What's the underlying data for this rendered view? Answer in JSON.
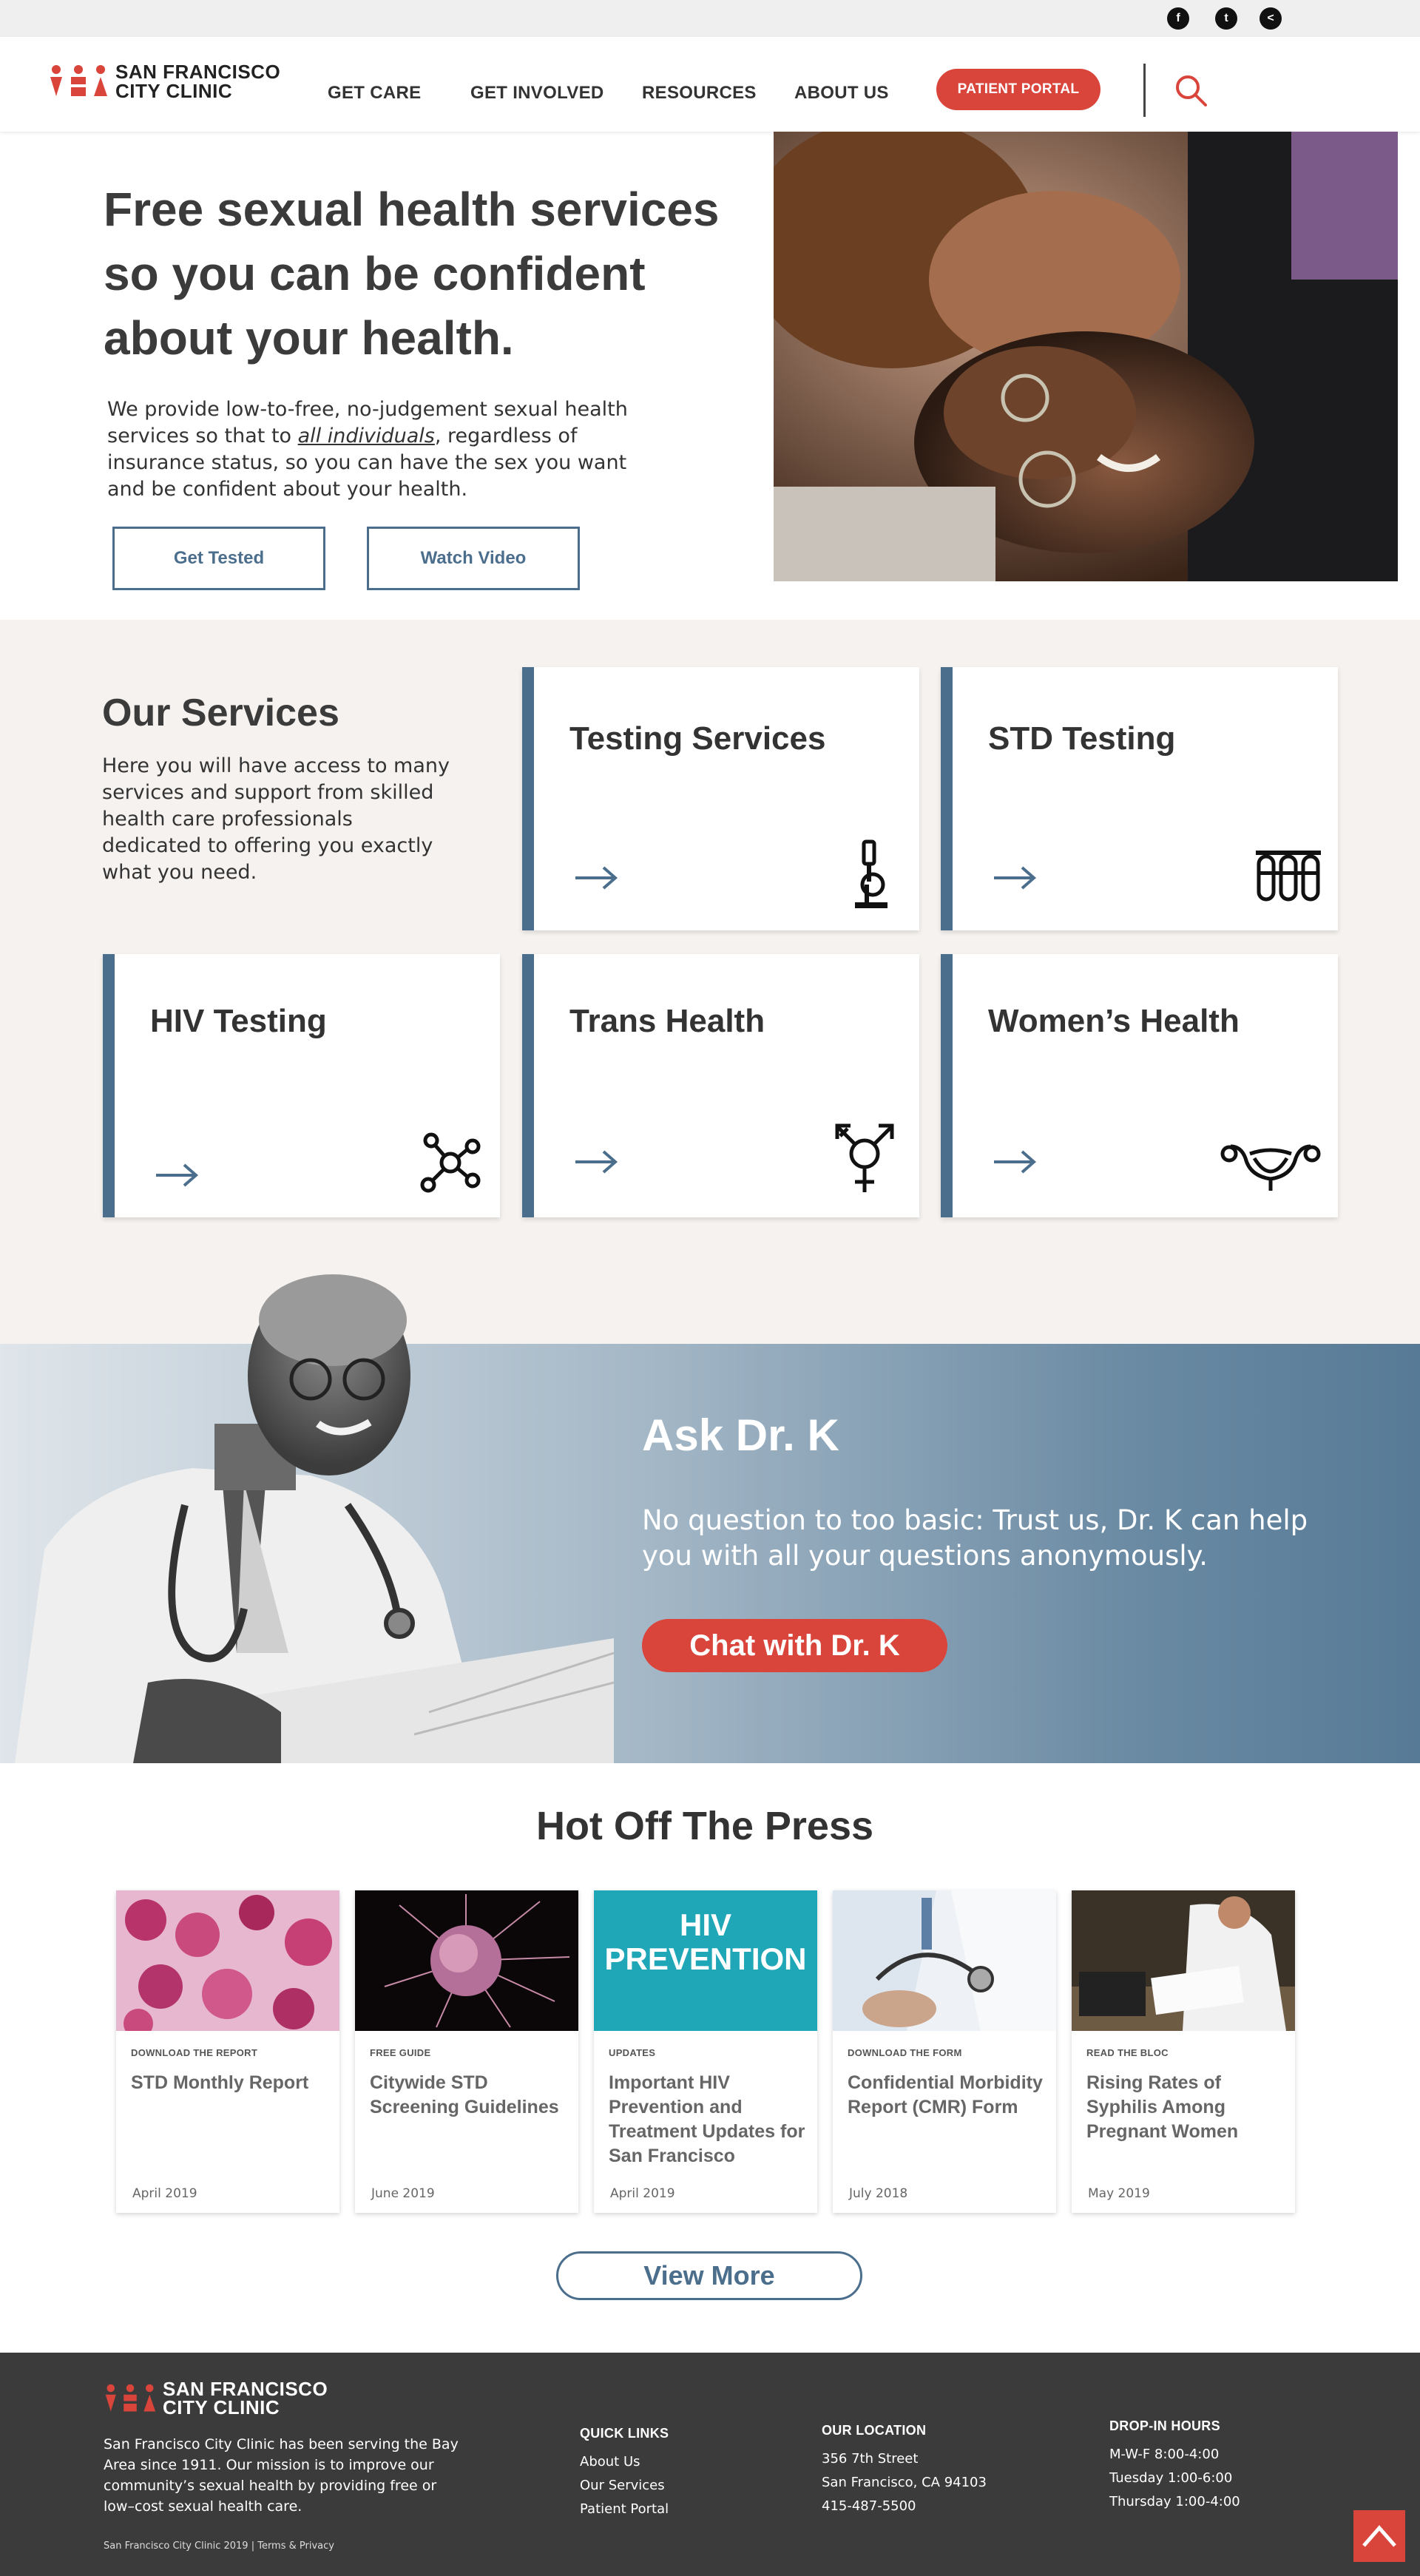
{
  "brand": {
    "name_line1": "SAN FRANCISCO",
    "name_line2": "CITY CLINIC",
    "accent_color": "#d9453b",
    "primary_color": "#4b6e8c"
  },
  "topbar": {
    "social": [
      {
        "name": "facebook-icon",
        "glyph": "f"
      },
      {
        "name": "twitter-icon",
        "glyph": "t"
      },
      {
        "name": "share-icon",
        "glyph": "<"
      }
    ]
  },
  "nav": {
    "items": [
      "GET CARE",
      "GET INVOLVED",
      "RESOURCES",
      "ABOUT US"
    ],
    "portal_label": "PATIENT PORTAL",
    "search_icon": "search-icon"
  },
  "hero": {
    "title": "Free sexual health services so you can be confident about your health.",
    "text_before": "We provide low-to-free, no-judgement sexual health services so that to ",
    "text_emphasis": "all individuals",
    "text_after": ", regardless of insurance status, so you can have the sex you want and be confident about your health.",
    "buttons": [
      "Get Tested",
      "Watch Video"
    ]
  },
  "services": {
    "title": "Our Services",
    "text": "Here you will have access to many services and support from skilled health care professionals dedicated to offering you exactly what you need.",
    "cards": [
      {
        "title": "Testing Services",
        "icon": "microscope-icon"
      },
      {
        "title": "STD Testing",
        "icon": "test-tubes-icon"
      },
      {
        "title": "HIV Testing",
        "icon": "molecule-icon"
      },
      {
        "title": "Trans Health",
        "icon": "transgender-symbol-icon"
      },
      {
        "title": "Women’s Health",
        "icon": "uterus-icon"
      }
    ]
  },
  "ask": {
    "title": "Ask Dr. K",
    "text": "No question to too basic: Trust us, Dr. K can help you with all your questions anonymously.",
    "button": "Chat with Dr. K"
  },
  "press": {
    "title": "Hot Off The Press",
    "items": [
      {
        "kicker": "DOWNLOAD THE REPORT",
        "title": "STD Monthly Report",
        "date": "April 2019"
      },
      {
        "kicker": "FREE GUIDE",
        "title": "Citywide STD Screening Guidelines",
        "date": "June 2019"
      },
      {
        "kicker": "UPDATES",
        "title": "Important HIV Prevention and Treatment Updates for San Francisco",
        "date": "April 2019",
        "image_text": "HIV PREVENTION"
      },
      {
        "kicker": "DOWNLOAD THE FORM",
        "title": "Confidential Morbidity Report (CMR) Form",
        "date": "July 2018"
      },
      {
        "kicker": "READ THE BLOC",
        "title": "Rising Rates of Syphilis Among Pregnant Women",
        "date": "May 2019"
      }
    ],
    "view_more": "View More"
  },
  "footer": {
    "about": "San Francisco City Clinic has been serving the Bay Area since 1911. Our mission is to improve our community’s sexual health by providing free or low–cost sexual health care.",
    "copyright": "San Francisco City Clinic 2019  |  Terms & Privacy",
    "quick_links_title": "QUICK LINKS",
    "quick_links": [
      "About Us",
      "Our Services",
      "Patient Portal"
    ],
    "location_title": "OUR LOCATION",
    "location": [
      "356 7th Street",
      "San Francisco, CA 94103",
      "415-487-5500"
    ],
    "hours_title": "DROP-IN HOURS",
    "hours": [
      "M-W-F 8:00-4:00",
      "Tuesday 1:00-6:00",
      "Thursday 1:00-4:00"
    ]
  }
}
